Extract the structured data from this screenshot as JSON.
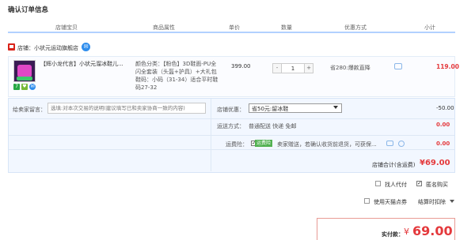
{
  "page_title": "确认订单信息",
  "columns": {
    "shop_item": "店铺宝贝",
    "attributes": "商品属性",
    "unit_price": "单价",
    "quantity": "数量",
    "discount": "优惠方式",
    "subtotal": "小计"
  },
  "shop": {
    "label": "店铺：小状元运动旗舰店",
    "wangwang_glyph": "✉"
  },
  "item": {
    "title": "【辉小龙代言】小状元溜冰鞋儿...",
    "badges": {
      "seven_day": "7",
      "heart": "♥",
      "msg": "✉"
    },
    "attr_lines": [
      "颜色分类：【粉色】3D鞋面-PU全",
      "闪全套装（头盔+护具）+大礼包",
      "鞋码：小码（31-34）适合平时鞋",
      "码27-32"
    ],
    "price": "399.00",
    "qty_minus": "-",
    "qty_value": "1",
    "qty_plus": "+",
    "promo": "省280:爆款直降",
    "subtotal": "119.00"
  },
  "options": {
    "message_label": "给卖家留言：",
    "message_placeholder": "选填:对本次交易的说明(建议填写已和卖家协商一致的内容)",
    "shop_discount_label": "店铺优惠：",
    "shop_discount_value": "省50元:留冰鞋",
    "shop_discount_amount": "-50.00",
    "shipping_label": "运送方式：",
    "shipping_value": "普通配送 快递 免邮",
    "shipping_amount": "0.00",
    "insurance_label": "运费险：",
    "insurance_tag": "运费险",
    "insurance_text": "卖家赠送，若确认收货前退货，可获保...",
    "insurance_amount": "0.00",
    "shop_total_label": "店铺合计(含运费)",
    "shop_total_value": "¥69.00"
  },
  "extras": {
    "proxy_pay": "找人代付",
    "anonymous": "匿名购买",
    "tmall_points": "使用天猫点券",
    "points_deduct": "结算时扣除"
  },
  "payment": {
    "label": "实付款：",
    "symbol": "¥",
    "value": "69.00"
  },
  "colors": {
    "price_red": "#e4393c",
    "header_line": "#b2d1ff",
    "options_bg": "#f2f7ff"
  }
}
